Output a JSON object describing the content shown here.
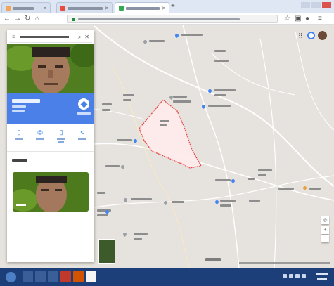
{
  "browser": {
    "tabs": [
      {
        "title": "",
        "color": "#f2a65a"
      },
      {
        "title": "",
        "color": "#e84c3d"
      },
      {
        "title": "",
        "color": "#34a853"
      }
    ],
    "url": ""
  },
  "sidebar": {
    "search_text": "",
    "place_name": "",
    "subtitle": "",
    "directions_label": "",
    "actions": [
      {
        "icon": "save-icon",
        "label": ""
      },
      {
        "icon": "nearby-icon",
        "label": ""
      },
      {
        "icon": "send-to-phone-icon",
        "label": ""
      },
      {
        "icon": "share-icon",
        "label": ""
      }
    ],
    "photos_heading": "",
    "photo_caption": ""
  },
  "map": {
    "labels": [],
    "attribution": ""
  },
  "colors": {
    "accent": "#4a80e8",
    "boundary": "#e84a4a",
    "map_bg": "#e6e2dd",
    "taskbar": "#1c3f7a"
  },
  "taskbar": {
    "clock": ""
  }
}
